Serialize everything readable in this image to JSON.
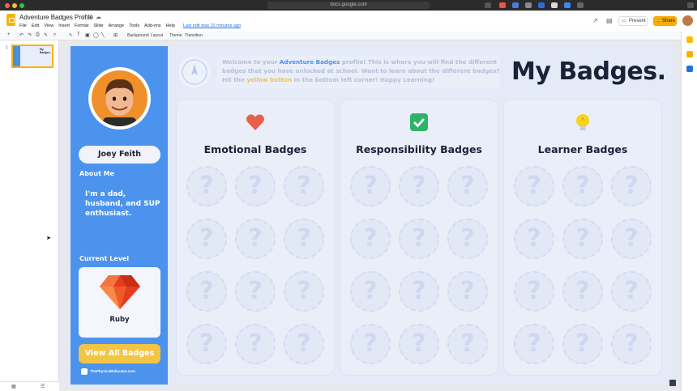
{
  "browser": {
    "url": "docs.google.com"
  },
  "app": {
    "doc_title": "Adventure Badges Profile",
    "menu": [
      "File",
      "Edit",
      "View",
      "Insert",
      "Format",
      "Slide",
      "Arrange",
      "Tools",
      "Add-ons",
      "Help"
    ],
    "last_edit": "Last edit was 10 minutes ago",
    "present_label": "Present",
    "share_label": "Share"
  },
  "toolbar": {
    "background_label": "Background",
    "layout_label": "Layout",
    "theme_label": "Theme",
    "transition_label": "Transition"
  },
  "filmstrip": {
    "slide_number": "1",
    "thumb_title": "My Badges."
  },
  "slide": {
    "profile": {
      "name": "Joey Feith",
      "about_label": "About Me",
      "about_text": "I'm a dad, husband, and SUP enthusiast.",
      "level_label": "Current Level",
      "level_name": "Ruby",
      "view_all_label": "View All Badges",
      "footer_brand": "ThePhysicalEducator.com"
    },
    "welcome": {
      "part1": "Welcome to your ",
      "brand": "Adventure Badges",
      "part2": " profile! This is where you will find the different badges that you have unlocked at school. Want to learn about the different badges? Hit the ",
      "button_word": "yellow button",
      "part3": " in the bottom left corner! Happy Learning!"
    },
    "page_title": "My Badges.",
    "columns": [
      {
        "title": "Emotional Badges",
        "icon": "heart-icon",
        "color": "#e8604c"
      },
      {
        "title": "Responsibility Badges",
        "icon": "checkmark-icon",
        "color": "#2fb36b"
      },
      {
        "title": "Learner Badges",
        "icon": "lightbulb-icon",
        "color": "#f5d31f"
      }
    ],
    "badge_placeholder": "?"
  },
  "colors": {
    "sidebar_blue": "#4c93ee",
    "accent_yellow": "#f3c544",
    "title_navy": "#1a2238",
    "ruby_red": "#e53b1e"
  }
}
